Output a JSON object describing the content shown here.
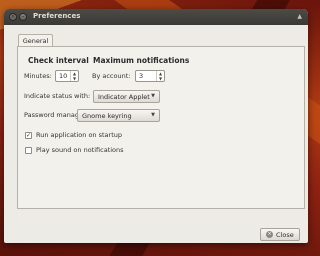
{
  "window": {
    "title": "Preferences"
  },
  "tabs": [
    {
      "label": "General",
      "active": true
    }
  ],
  "check_interval": {
    "heading": "Check interval",
    "minutes_label": "Minutes:",
    "minutes_value": "10"
  },
  "max_notifications": {
    "heading": "Maximum notifications",
    "by_account_label": "By account:",
    "by_account_value": "3"
  },
  "indicate_status": {
    "label": "Indicate status with:",
    "value": "Indicator Applet"
  },
  "password_manager": {
    "label": "Password manager:",
    "value": "Gnome keyring"
  },
  "options": {
    "run_on_startup": {
      "label": "Run application on startup",
      "checked": true
    },
    "play_sound": {
      "label": "Play sound on notifications",
      "checked": false
    }
  },
  "buttons": {
    "close": "Close"
  }
}
